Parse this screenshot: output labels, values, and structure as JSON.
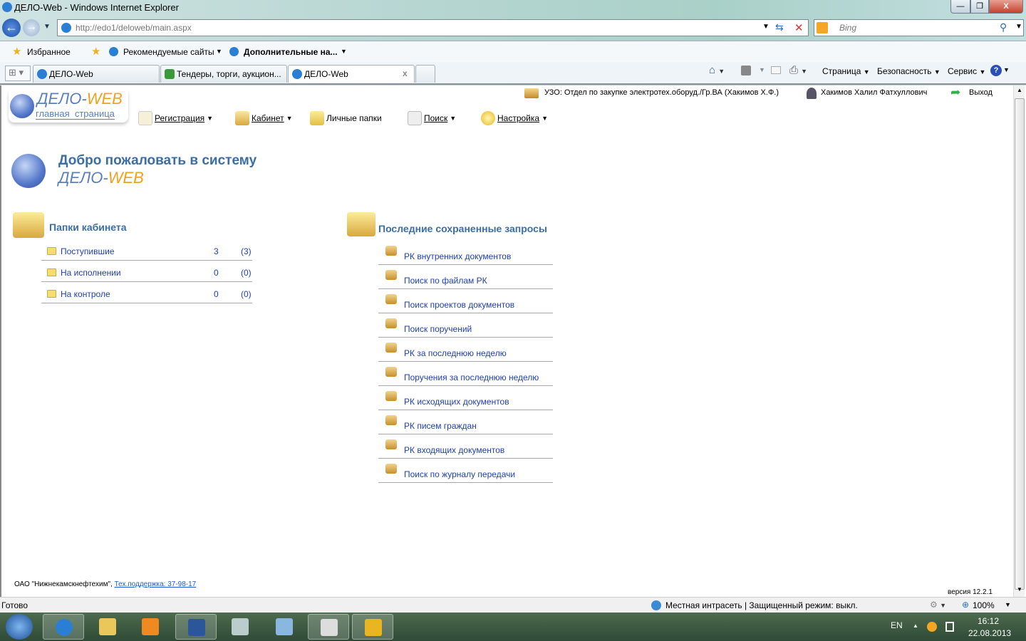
{
  "window": {
    "title": "ДЕЛО-Web - Windows Internet Explorer",
    "min": "—",
    "max": "❐",
    "close": "X"
  },
  "address": {
    "url": "http://edo1/deloweb/main.aspx",
    "search_placeholder": "Bing"
  },
  "favorites": {
    "favorites": "Избранное",
    "suggested": "Рекомендуемые сайты",
    "more": "Дополнительные на..."
  },
  "tabs": [
    {
      "label": "ДЕЛО-Web"
    },
    {
      "label": "Тендеры, торги, аукцион..."
    },
    {
      "label": "ДЕЛО-Web",
      "close": "x"
    }
  ],
  "commandbar": {
    "page": "Страница",
    "safety": "Безопасность",
    "tools": "Сервис",
    "help": "?"
  },
  "header": {
    "logo_main": "ДЕЛО-",
    "logo_web": "WEB",
    "logo_sub": "главная  страница",
    "department": "УЗО: Отдел по закупке электротех.оборуд./Гр.ВА (Хакимов Х.Ф.)",
    "user": "Хакимов Халил Фатхуллович",
    "logout": "Выход"
  },
  "menu": [
    {
      "label": "Регистрация"
    },
    {
      "label": "Кабинет"
    },
    {
      "label": "Личные папки"
    },
    {
      "label": "Поиск"
    },
    {
      "label": "Настройка"
    }
  ],
  "welcome": {
    "line1": "Добро пожаловать в систему",
    "line2a": "ДЕЛО-",
    "line2b": "WEB"
  },
  "folders": {
    "title": "Папки кабинета",
    "items": [
      {
        "name": "Поступившие",
        "count": "3",
        "total": "(3)"
      },
      {
        "name": "На исполнении",
        "count": "0",
        "total": "(0)"
      },
      {
        "name": "На контроле",
        "count": "0",
        "total": "(0)"
      }
    ]
  },
  "queries": {
    "title": "Последние сохраненные запросы",
    "items": [
      "РК внутренних документов",
      "Поиск по файлам РК",
      "Поиск проектов документов",
      "Поиск поручений",
      "РК за последнюю неделю",
      "Поручения за последнюю неделю",
      "РК исходящих документов",
      "РК писем граждан",
      "РК входящих документов",
      "Поиск по журналу передачи"
    ]
  },
  "footer": {
    "company": "ОАО \"Нижнекамскнефтехим\", ",
    "support": "Тех.поддержка: 37-98-17",
    "version": "версия 12.2.1"
  },
  "status": {
    "ready": "Готово",
    "zone": "Местная интрасеть | Защищенный режим: выкл.",
    "zoom": "100%"
  },
  "taskbar": {
    "lang": "EN",
    "time": "16:12",
    "date": "22.08.2013"
  }
}
